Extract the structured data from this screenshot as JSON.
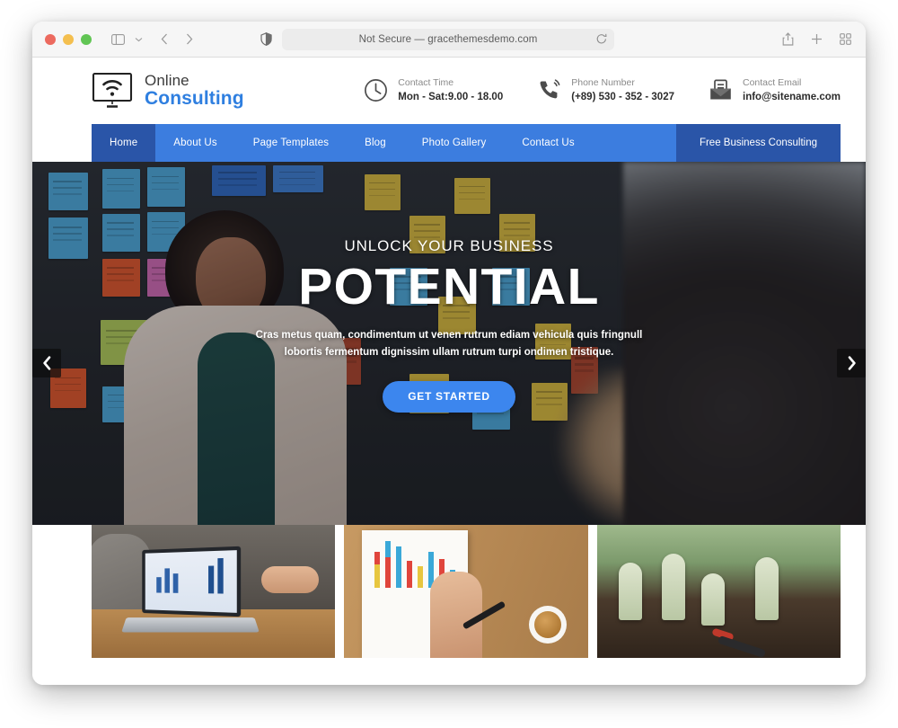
{
  "browser": {
    "url_text": "Not Secure — gracethemesdemo.com",
    "icons": {
      "sidebar": "sidebar-icon",
      "chevron_down": "chevron-down-icon",
      "back": "back-arrow-icon",
      "forward": "forward-arrow-icon",
      "shield": "shield-icon",
      "reload": "reload-icon",
      "share": "share-icon",
      "new_tab": "plus-icon",
      "tab_overview": "tab-overview-icon"
    },
    "traffic_lights": [
      "close",
      "minimize",
      "zoom"
    ]
  },
  "site": {
    "logo": {
      "line1": "Online",
      "line2": "Consulting",
      "icon": "monitor-wifi-icon"
    },
    "contacts": [
      {
        "icon": "clock-icon",
        "label": "Contact Time",
        "value": "Mon - Sat:9.00 - 18.00"
      },
      {
        "icon": "phone-icon",
        "label": "Phone Number",
        "value": "(+89) 530 - 352 - 3027"
      },
      {
        "icon": "envelope-icon",
        "label": "Contact Email",
        "value": "info@sitename.com"
      }
    ],
    "nav": {
      "items": [
        {
          "label": "Home",
          "active": true
        },
        {
          "label": "About Us",
          "active": false
        },
        {
          "label": "Page Templates",
          "active": false
        },
        {
          "label": "Blog",
          "active": false
        },
        {
          "label": "Photo Gallery",
          "active": false
        },
        {
          "label": "Contact Us",
          "active": false
        }
      ],
      "cta_label": "Free Business Consulting"
    },
    "hero": {
      "subtitle": "UNLOCK YOUR BUSINESS",
      "title": "POTENTIAL",
      "description": "Cras metus quam, condimentum ut venen rutrum ediam vehicula quis fringnull lobortis fermentum dignissim ullam rutrum turpi ondimen tristique.",
      "button_label": "GET STARTED",
      "slide_count": 3,
      "active_slide": 3,
      "prev_icon": "chevron-left-icon",
      "next_icon": "chevron-right-icon"
    },
    "services": [
      {
        "name": "laptop-analytics-image"
      },
      {
        "name": "chart-report-image"
      },
      {
        "name": "money-growth-image"
      }
    ],
    "colors": {
      "nav_blue": "#3c7ddf",
      "active_blue": "#2a55a8",
      "button_blue": "#3c86ee",
      "logo_blue": "#2f7fe0"
    }
  }
}
